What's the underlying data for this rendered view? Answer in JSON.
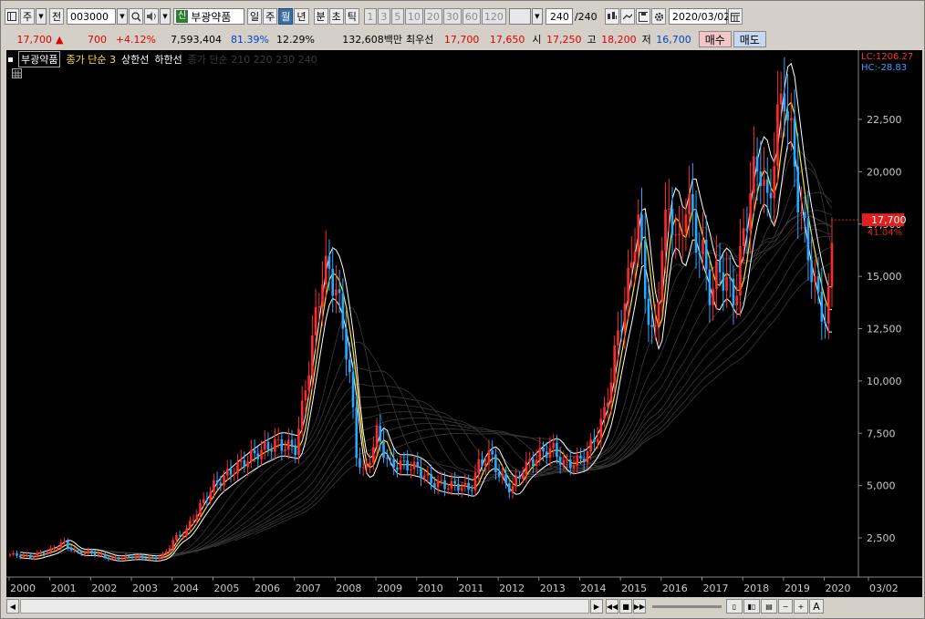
{
  "toolbar": {
    "period_code": "주",
    "prev_label": "전",
    "stock_code": "003000",
    "stock_badge": "신",
    "stock_name": "부광약품",
    "periods": [
      "일",
      "주",
      "월",
      "년"
    ],
    "selected_period": "월",
    "intraday": [
      "분",
      "초",
      "틱"
    ],
    "intervals": [
      "1",
      "3",
      "5",
      "10",
      "20",
      "30",
      "60",
      "120"
    ],
    "count_value": "240",
    "count_total": "/240",
    "date": "2020/03/02"
  },
  "quote": {
    "price": "17,700",
    "arrow": "▲",
    "change": "700",
    "change_pct": "+4.12%",
    "volume": "7,593,404",
    "vol_ratio": "81.39%",
    "turnover": "12.29%",
    "amount": "132,608백만",
    "pref_label": "최우선",
    "ask": "17,700",
    "bid": "17,650",
    "open_label": "시",
    "open": "17,250",
    "high_label": "고",
    "high": "18,200",
    "low_label": "저",
    "low": "16,700",
    "buy_label": "매수",
    "sell_label": "매도"
  },
  "legend": {
    "name": "부광약품",
    "items": [
      "종가 단순 3",
      "상한선",
      "하한선"
    ],
    "faded": "종가 단순 210  220  230  240"
  },
  "colors": {
    "up": "#ff2a2a",
    "down": "#2aa8ff",
    "ma": "#ffe030",
    "band": "#ffffff",
    "axis": "#c8c8c8",
    "price_tag": "#e02020"
  },
  "chart_data": {
    "type": "candlestick",
    "title": "",
    "lc": "LC:1206.27",
    "hc": "HC:-28.83",
    "y_ticks": [
      "22,500",
      "20,000",
      "17,500",
      "15,000",
      "12,500",
      "10,000",
      "7,500",
      "5,000",
      "2,500"
    ],
    "y_values": [
      22500,
      20000,
      17500,
      15000,
      12500,
      10000,
      7500,
      5000,
      2500
    ],
    "ylim": [
      0,
      25000
    ],
    "x_labels": [
      "2000",
      "2001",
      "2002",
      "2003",
      "2004",
      "2005",
      "2006",
      "2007",
      "2008",
      "2009",
      "2010",
      "2011",
      "2012",
      "2013",
      "2014",
      "2015",
      "2016",
      "2017",
      "2018",
      "2019",
      "2020",
      "03/02"
    ],
    "current_price_label": "17,700",
    "current_price": 17700,
    "current_pct": "41.04%",
    "close_series": [
      [
        2000.0,
        1700
      ],
      [
        2000.5,
        1600
      ],
      [
        2001.0,
        1900
      ],
      [
        2001.3,
        2300
      ],
      [
        2001.6,
        1800
      ],
      [
        2002.0,
        1800
      ],
      [
        2002.5,
        1500
      ],
      [
        2003.0,
        1600
      ],
      [
        2003.5,
        1500
      ],
      [
        2003.8,
        1700
      ],
      [
        2004.0,
        2400
      ],
      [
        2004.3,
        2800
      ],
      [
        2004.6,
        3800
      ],
      [
        2005.0,
        5000
      ],
      [
        2005.5,
        5800
      ],
      [
        2006.0,
        6500
      ],
      [
        2006.5,
        7000
      ],
      [
        2007.0,
        6800
      ],
      [
        2007.2,
        9000
      ],
      [
        2007.5,
        13000
      ],
      [
        2007.7,
        15500
      ],
      [
        2008.0,
        14500
      ],
      [
        2008.3,
        11000
      ],
      [
        2008.5,
        6500
      ],
      [
        2008.7,
        5500
      ],
      [
        2009.0,
        7500
      ],
      [
        2009.3,
        6000
      ],
      [
        2009.7,
        6000
      ],
      [
        2010.0,
        5800
      ],
      [
        2010.3,
        5200
      ],
      [
        2010.7,
        5000
      ],
      [
        2011.0,
        5000
      ],
      [
        2011.3,
        4800
      ],
      [
        2011.5,
        6000
      ],
      [
        2011.8,
        6500
      ],
      [
        2012.0,
        5500
      ],
      [
        2012.3,
        4800
      ],
      [
        2012.6,
        5800
      ],
      [
        2013.0,
        6500
      ],
      [
        2013.3,
        6800
      ],
      [
        2013.6,
        6000
      ],
      [
        2014.0,
        6200
      ],
      [
        2014.3,
        7000
      ],
      [
        2014.6,
        8500
      ],
      [
        2014.9,
        12000
      ],
      [
        2015.2,
        15000
      ],
      [
        2015.4,
        18000
      ],
      [
        2015.6,
        14000
      ],
      [
        2015.8,
        11500
      ],
      [
        2016.0,
        16500
      ],
      [
        2016.2,
        18500
      ],
      [
        2016.4,
        16000
      ],
      [
        2016.6,
        19000
      ],
      [
        2016.8,
        17000
      ],
      [
        2017.0,
        16000
      ],
      [
        2017.2,
        14000
      ],
      [
        2017.4,
        15500
      ],
      [
        2017.6,
        14500
      ],
      [
        2017.8,
        14000
      ],
      [
        2018.0,
        17000
      ],
      [
        2018.2,
        19500
      ],
      [
        2018.4,
        20500
      ],
      [
        2018.6,
        18000
      ],
      [
        2018.8,
        22000
      ],
      [
        2019.0,
        24000
      ],
      [
        2019.2,
        21000
      ],
      [
        2019.4,
        18000
      ],
      [
        2019.6,
        16000
      ],
      [
        2019.8,
        14000
      ],
      [
        2020.0,
        13000
      ],
      [
        2020.1,
        14000
      ],
      [
        2020.2,
        17700
      ]
    ]
  }
}
